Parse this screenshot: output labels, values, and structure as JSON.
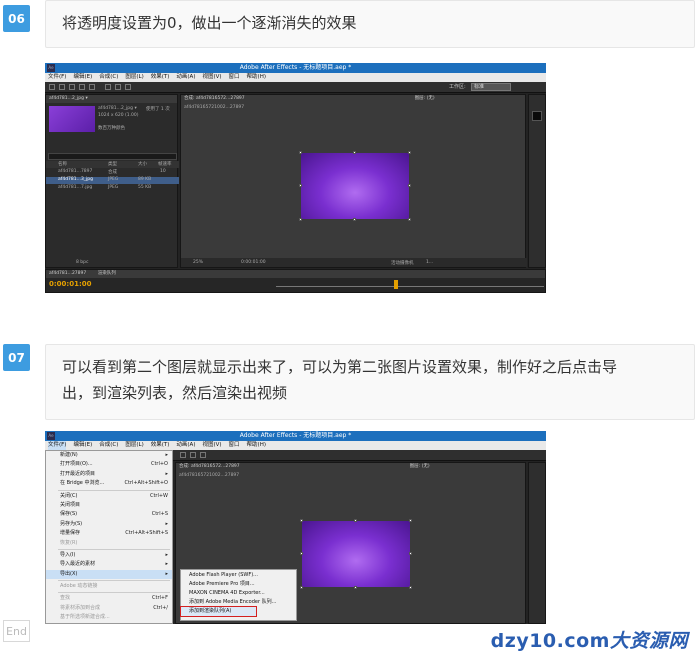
{
  "steps": [
    {
      "number": "06",
      "text": "将透明度设置为0，做出一个逐渐消失的效果"
    },
    {
      "number": "07",
      "text_line1": "可以看到第二个图层就显示出来了，可以为第二张图片设置效果，制作好之后点击导",
      "text_line2": "出，到渲染列表，然后渲染出视频"
    }
  ],
  "end_label": "End",
  "watermark": {
    "domain": "dzy10.com",
    "brand": "大资源网"
  },
  "ae_window": {
    "title": "Adobe After Effects - 无标题项目.aep *",
    "menu": [
      "文件(F)",
      "编辑(E)",
      "合成(C)",
      "图层(L)",
      "效果(T)",
      "动画(A)",
      "视图(V)",
      "窗口",
      "帮助(H)"
    ],
    "workspace_label": "工作区:",
    "workspace_value": "标准",
    "project_item_name": "af4d781...2_jpg ▾",
    "project_item_used": "使用了 1 次",
    "project_item_size": "1024 x 620 (1.00)",
    "project_item_color": "数百万种颜色",
    "project_columns": [
      "名称",
      "类型",
      "大小",
      "帧速率"
    ],
    "project_rows": [
      {
        "name": "af4d781...7897",
        "type": "合成",
        "size": "",
        "fps": "10"
      },
      {
        "name": "af4d781...3_jpg",
        "type": "JPEG",
        "size": "89 KB",
        "fps": ""
      },
      {
        "name": "af4d781...7.jpg",
        "type": "JPEG",
        "size": "55 KB",
        "fps": ""
      }
    ],
    "bpc": "8 bpc",
    "comp_tab": "合成: af4d7816572...27897",
    "comp_breadcrumb": "af4d78165721002...27897",
    "layer_label": "图层: (无)",
    "zoom": "25%",
    "timecode_view": "0:00:01:00",
    "view_option": "活动摄像机",
    "view_count": "1...",
    "timeline_tab": "af4d781...27897",
    "render_tab": "渲染队列",
    "timecode": "0:00:01:00",
    "file_menu_items": [
      {
        "label": "新建(N)",
        "shortcut": "",
        "disabled": false
      },
      {
        "label": "打开项目(O)...",
        "shortcut": "Ctrl+O",
        "disabled": false
      },
      {
        "label": "打开最近的项目",
        "shortcut": "",
        "disabled": false
      },
      {
        "label": "在 Bridge 中浏览...",
        "shortcut": "Ctrl+Alt+Shift+O",
        "disabled": false
      },
      {
        "label": "关闭(C)",
        "shortcut": "Ctrl+W",
        "disabled": false
      },
      {
        "label": "关闭项目",
        "shortcut": "",
        "disabled": false
      },
      {
        "label": "保存(S)",
        "shortcut": "Ctrl+S",
        "disabled": false
      },
      {
        "label": "另存为(S)",
        "shortcut": "",
        "disabled": false
      },
      {
        "label": "增量保存",
        "shortcut": "Ctrl+Alt+Shift+S",
        "disabled": false
      },
      {
        "label": "恢复(R)",
        "shortcut": "",
        "disabled": true
      },
      {
        "label": "导入(I)",
        "shortcut": "",
        "disabled": false
      },
      {
        "label": "导入最近的素材",
        "shortcut": "",
        "disabled": false
      },
      {
        "label": "导出(X)",
        "shortcut": "",
        "disabled": false,
        "active": true
      },
      {
        "label": "Adobe 动态链接",
        "shortcut": "",
        "disabled": true
      },
      {
        "label": "查找",
        "shortcut": "Ctrl+F",
        "disabled": true
      },
      {
        "label": "将素材添加到合成",
        "shortcut": "Ctrl+/",
        "disabled": true
      },
      {
        "label": "基于所选项新建合成...",
        "shortcut": "",
        "disabled": true
      }
    ],
    "export_submenu": [
      "Adobe Flash Player (SWF)...",
      "Adobe Premiere Pro 项目...",
      "MAXON CINEMA 4D Exporter...",
      "添加到 Adobe Media Encoder 队列...",
      "添加到渲染队列(A)"
    ]
  }
}
